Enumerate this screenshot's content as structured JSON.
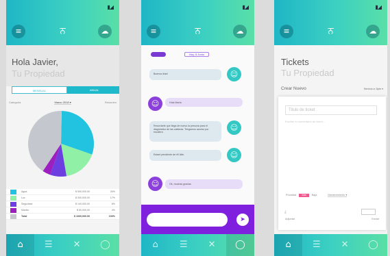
{
  "status": {
    "battery_glyph": "▮◢"
  },
  "header": {
    "menu_icon": "menu-icon",
    "logo_glyph": "ਨ",
    "cloud_icon": "cloud-icon"
  },
  "tabs": [
    {
      "icon": "home-icon",
      "glyph": "⌂"
    },
    {
      "icon": "list-icon",
      "glyph": "☰"
    },
    {
      "icon": "tools-icon",
      "glyph": "✕"
    },
    {
      "icon": "chat-icon",
      "glyph": "◯"
    }
  ],
  "screen1": {
    "greeting": "Hola Javier,",
    "property": "Tu Propiedad",
    "seg_left": "Mensual",
    "seg_right": "Anual",
    "filter_left": "Categoria",
    "filter_center": "Marzo 2018 ▾",
    "filter_right": "Resumen",
    "legend": [
      {
        "name": "Agua",
        "amount": "$ 500,000.00",
        "pct": "30%",
        "color": "#21c3e0"
      },
      {
        "name": "Luz",
        "amount": "$ 300,000.00",
        "pct": "17%",
        "color": "#8ff0a6"
      },
      {
        "name": "Seguridad",
        "amount": "$ 140,000.00",
        "pct": "8%",
        "color": "#6d3ee0"
      },
      {
        "name": "Mantto.",
        "amount": "$ 60,000.00",
        "pct": "4%",
        "color": "#9d1fbf"
      },
      {
        "name": "Total",
        "amount": "$ 1000,000.00",
        "pct": "100%",
        "color": "#c4c8ce"
      }
    ],
    "pie": [
      {
        "value": 30,
        "color": "#21c3e0"
      },
      {
        "value": 17,
        "color": "#8ff0a6"
      },
      {
        "value": 8,
        "color": "#6d3ee0"
      },
      {
        "value": 4,
        "color": "#9d1fbf"
      },
      {
        "value": 41,
        "color": "#c4c8ce"
      }
    ]
  },
  "screen2": {
    "pill": "Hoy, 5 Junio",
    "messages": [
      {
        "text": "Buenos días!",
        "side": "me"
      },
      {
        "text": "Hola Marta",
        "side": "them"
      },
      {
        "text": "Recordarte que llega de nuevo la persona para el diagnóstico de las calderas. Tengamos acceso por escalera",
        "side": "me"
      },
      {
        "text": "Estaré pendiente de él! Atte.",
        "side": "me"
      },
      {
        "text": "Ok, muchas gracias",
        "side": "them"
      }
    ],
    "input_placeholder": "",
    "send_glyph": "➤"
  },
  "screen3": {
    "title": "Tickets",
    "property": "Tu Propiedad",
    "create_label": "Crear Nuevo",
    "create_dropdown": "Servicio a: Dpto ▾",
    "subject_placeholder": "Titulo de ticket",
    "description_placeholder": "Escribe tu comentario de ticket...",
    "priority_label": "Prioridad",
    "priority_value": "Alta",
    "priority_low": "Baja",
    "department": "Mantenimiento ▾",
    "attach_label": "Adjuntar",
    "send_label": "Enviar"
  }
}
